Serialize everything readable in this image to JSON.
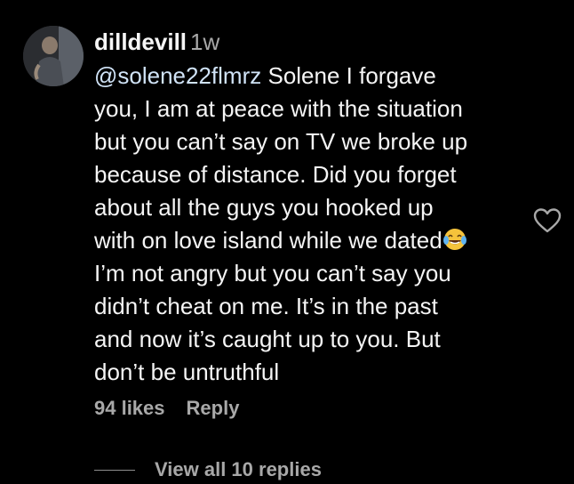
{
  "comment": {
    "username": "dilldevill",
    "time": "1w",
    "mention": "@solene22flmrz",
    "lines": [
      " Solene I forgave",
      "you, I am at peace with the situation",
      "but you can’t say on TV we broke up",
      "because of distance. Did you forget",
      "about all the guys you hooked up",
      "with on love island while we dated",
      "I’m not angry but you can’t say you",
      "didn’t cheat on me. It’s in the past",
      "and now it’s caught up to you. But",
      "don’t be untruthful"
    ],
    "emoji": "face-with-tears-of-joy-icon"
  },
  "actions": {
    "likes": "94 likes",
    "reply": "Reply"
  },
  "replies": {
    "label": "View all 10 replies"
  },
  "colors": {
    "background": "#000000",
    "text": "#f5f5f5",
    "muted": "#a8a8a8",
    "mention": "#d0e3f7"
  }
}
